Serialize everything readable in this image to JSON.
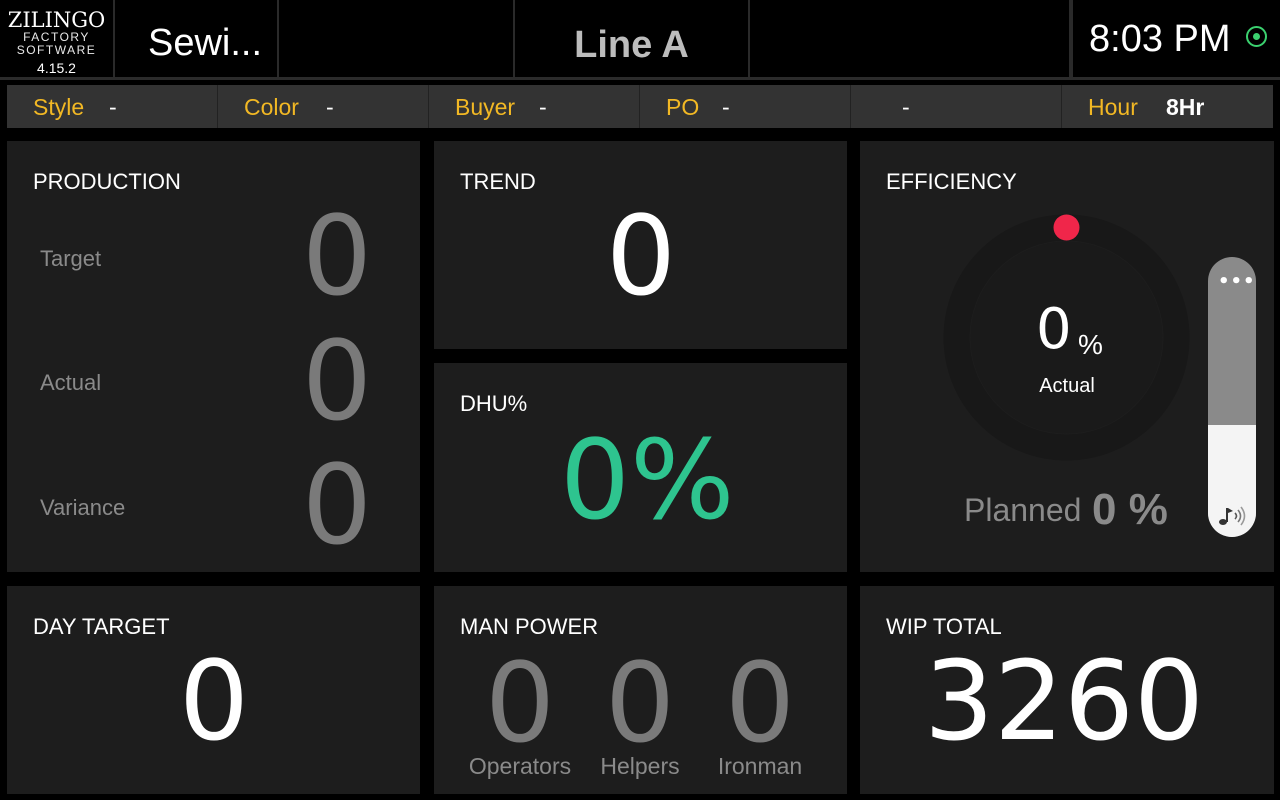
{
  "header": {
    "logo_name": "ZILINGO",
    "logo_line1": "FACTORY",
    "logo_line2": "SOFTWARE",
    "version": "4.15.2",
    "section_title": "Sewi...",
    "line_name": "Line A",
    "time": "8:03 PM",
    "status_color": "#3bd16f"
  },
  "infobar": {
    "style_label": "Style",
    "style_value": "-",
    "color_label": "Color",
    "color_value": "-",
    "buyer_label": "Buyer",
    "buyer_value": "-",
    "po_label": "PO",
    "po_value": "-",
    "blank_value": "-",
    "hour_label": "Hour",
    "hour_value": "8Hr"
  },
  "production": {
    "title": "PRODUCTION",
    "target_label": "Target",
    "target_value": "0",
    "actual_label": "Actual",
    "actual_value": "0",
    "variance_label": "Variance",
    "variance_value": "0"
  },
  "trend": {
    "title": "TREND",
    "value": "0"
  },
  "dhu": {
    "title": "DHU%",
    "value": "0%",
    "color": "#2ec48f"
  },
  "efficiency": {
    "title": "EFFICIENCY",
    "actual_value": "0",
    "actual_unit": "%",
    "actual_label": "Actual",
    "planned_label": "Planned",
    "planned_value": "0 %",
    "indicator_color": "#f0264a",
    "volume_level": 0.4
  },
  "day_target": {
    "title": "DAY TARGET",
    "value": "0"
  },
  "man_power": {
    "title": "MAN POWER",
    "operators_value": "0",
    "operators_label": "Operators",
    "helpers_value": "0",
    "helpers_label": "Helpers",
    "ironman_value": "0",
    "ironman_label": "Ironman"
  },
  "wip": {
    "title": "WIP TOTAL",
    "value": "3260"
  }
}
